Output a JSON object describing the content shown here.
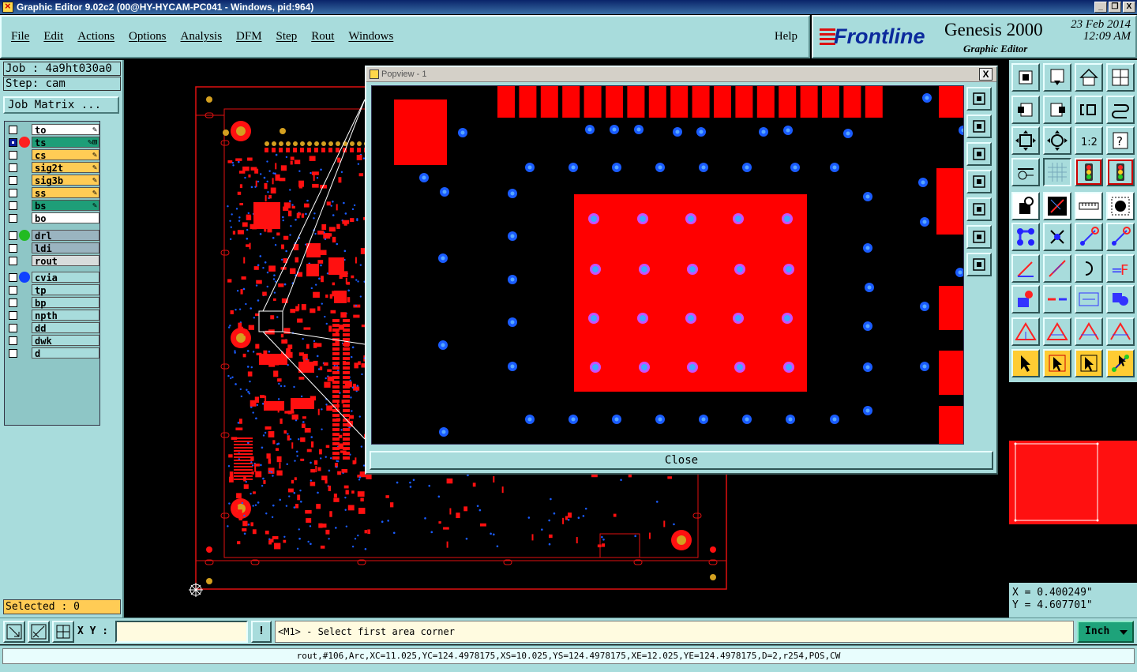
{
  "window": {
    "title": "Graphic Editor 9.02c2 (00@HY-HYCAM-PC041 - Windows, pid:964)",
    "controls": [
      "_",
      "❐",
      "X"
    ]
  },
  "menu": {
    "items": [
      "File",
      "Edit",
      "Actions",
      "Options",
      "Analysis",
      "DFM",
      "Step",
      "Rout",
      "Windows"
    ],
    "help": "Help"
  },
  "brand": {
    "logo": "Frontline",
    "product": "Genesis 2000",
    "subtitle": "Graphic Editor",
    "date": "23 Feb 2014",
    "time": "12:09 AM"
  },
  "job": {
    "job_label": "Job : 4a9ht030a0",
    "step_label": "Step: cam",
    "matrix_button": "Job Matrix ..."
  },
  "layers": {
    "group1": [
      {
        "name": "to",
        "color": "#ffffff",
        "pen": "✎",
        "dot": ""
      },
      {
        "name": "ts",
        "color": "#1e9e78",
        "pen": "✎⊞",
        "dot": "#ff2020",
        "selected": true
      },
      {
        "name": "cs",
        "color": "#ffcc55",
        "pen": "✎",
        "dot": ""
      },
      {
        "name": "sig2t",
        "color": "#ffcc55",
        "pen": "✎",
        "dot": ""
      },
      {
        "name": "sig3b",
        "color": "#ffcc55",
        "pen": "✎",
        "dot": ""
      },
      {
        "name": "ss",
        "color": "#ffcc55",
        "pen": "✎",
        "dot": ""
      },
      {
        "name": "bs",
        "color": "#1e9e78",
        "pen": "✎",
        "dot": ""
      },
      {
        "name": "bo",
        "color": "#ffffff",
        "pen": "",
        "dot": ""
      }
    ],
    "group2": [
      {
        "name": "drl",
        "color": "#9ab4c0",
        "pen": "",
        "dot": "#22bb22"
      },
      {
        "name": "ldi",
        "color": "#9ab4c0",
        "pen": "",
        "dot": ""
      },
      {
        "name": "rout",
        "color": "#d8dcdc",
        "pen": "",
        "dot": ""
      }
    ],
    "group3": [
      {
        "name": "cvia",
        "color": "#a8dcdc",
        "pen": "",
        "dot": "#1040ff"
      },
      {
        "name": "tp",
        "color": "#a8dcdc",
        "pen": "",
        "dot": ""
      },
      {
        "name": "bp",
        "color": "#a8dcdc",
        "pen": "",
        "dot": ""
      },
      {
        "name": "npth",
        "color": "#a8dcdc",
        "pen": "",
        "dot": ""
      },
      {
        "name": "dd",
        "color": "#a8dcdc",
        "pen": "",
        "dot": ""
      },
      {
        "name": "dwk",
        "color": "#a8dcdc",
        "pen": "",
        "dot": ""
      },
      {
        "name": "d",
        "color": "#a8dcdc",
        "pen": "",
        "dot": ""
      }
    ]
  },
  "selected": "Selected : 0",
  "popview": {
    "title": "Popview - 1",
    "close_x": "X",
    "close_button": "Close"
  },
  "coords": {
    "x": "X = 0.400249\"",
    "y": "Y = 4.607701\""
  },
  "bottom": {
    "xy_label": "X Y :",
    "xy_value": "",
    "warn_icon": "!",
    "prompt": "<M1> - Select first area corner",
    "units": "Inch"
  },
  "status": "rout,#106,Arc,XC=11.025,YC=124.4978175,XS=10.025,YS=124.4978175,XE=12.025,YE=124.4978175,D=2,r254,POS,CW",
  "colors": {
    "panel": "#a8dcdc",
    "pad": "#ff0000",
    "via": "#1a5cff",
    "outline": "#e01010",
    "hole": "#d4a020"
  }
}
